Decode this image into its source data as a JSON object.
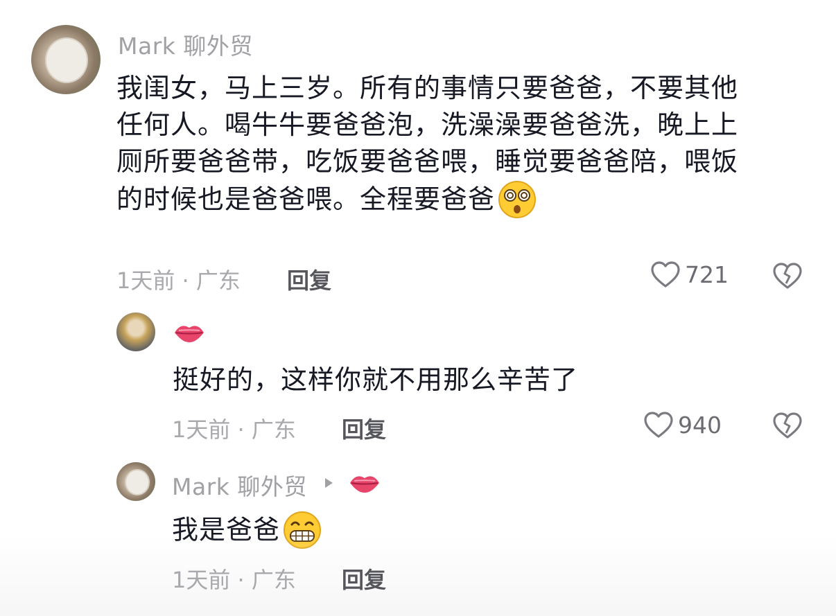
{
  "comments": [
    {
      "username": "Mark 聊外贸",
      "text": "我闺女，马上三岁。所有的事情只要爸爸，不要其他任何人。喝牛牛要爸爸泡，洗澡澡要爸爸洗，晚上上厕所要爸爸带，吃饭要爸爸喂，睡觉要爸爸陪，喂饭的时候也是爸爸喂。全程要爸爸",
      "text_lines": [
        "我闺女，马上三岁。所有的事情只要爸爸，不要其他",
        "任何人。喝牛牛要爸爸泡，洗澡澡要爸爸洗，晚上上",
        "厕所要爸爸带，吃饭要爸爸喂，睡觉要爸爸陪，喂饭",
        "的时候也是爸爸喂。全程要爸爸"
      ],
      "emoji": "dizzy-face-emoji",
      "time_location": "1天前 · 广东",
      "reply_label": "回复",
      "likes": "721"
    },
    {
      "username_emoji": "lips-emoji",
      "text": "挺好的，这样你就不用那么辛苦了",
      "time_location": "1天前 · 广东",
      "reply_label": "回复",
      "likes": "940"
    },
    {
      "username": "Mark 聊外贸",
      "reply_to_emoji": "lips-emoji",
      "text": "我是爸爸",
      "emoji": "grinning-face-emoji",
      "time_location": "1天前 · 广东",
      "reply_label": "回复"
    }
  ],
  "colors": {
    "username": "#a0a0a5",
    "text": "#161823",
    "meta": "#a8a8ad",
    "reply": "#55555c",
    "icon": "#7a7a80"
  }
}
